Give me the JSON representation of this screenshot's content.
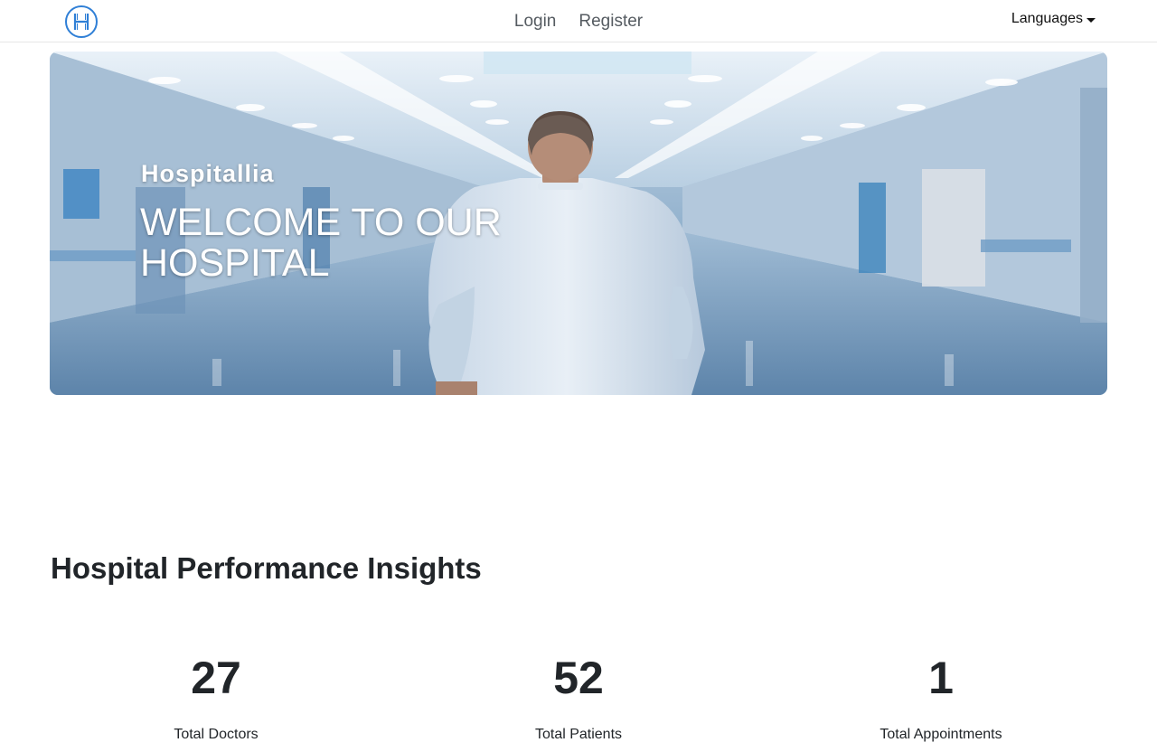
{
  "nav": {
    "logo_letter": "H",
    "links": [
      "Login",
      "Register"
    ],
    "languages_label": "Languages"
  },
  "hero": {
    "subtitle": "Hospitallia",
    "title": "WELCOME TO OUR HOSPITAL"
  },
  "insights": {
    "title": "Hospital Performance Insights",
    "stats": [
      {
        "value": "27",
        "label": "Total Doctors"
      },
      {
        "value": "52",
        "label": "Total Patients"
      },
      {
        "value": "1",
        "label": "Total Appointments"
      }
    ]
  },
  "colors": {
    "logo_blue": "#2f7fd6",
    "text_dark": "#212529",
    "nav_text": "#555b61"
  }
}
